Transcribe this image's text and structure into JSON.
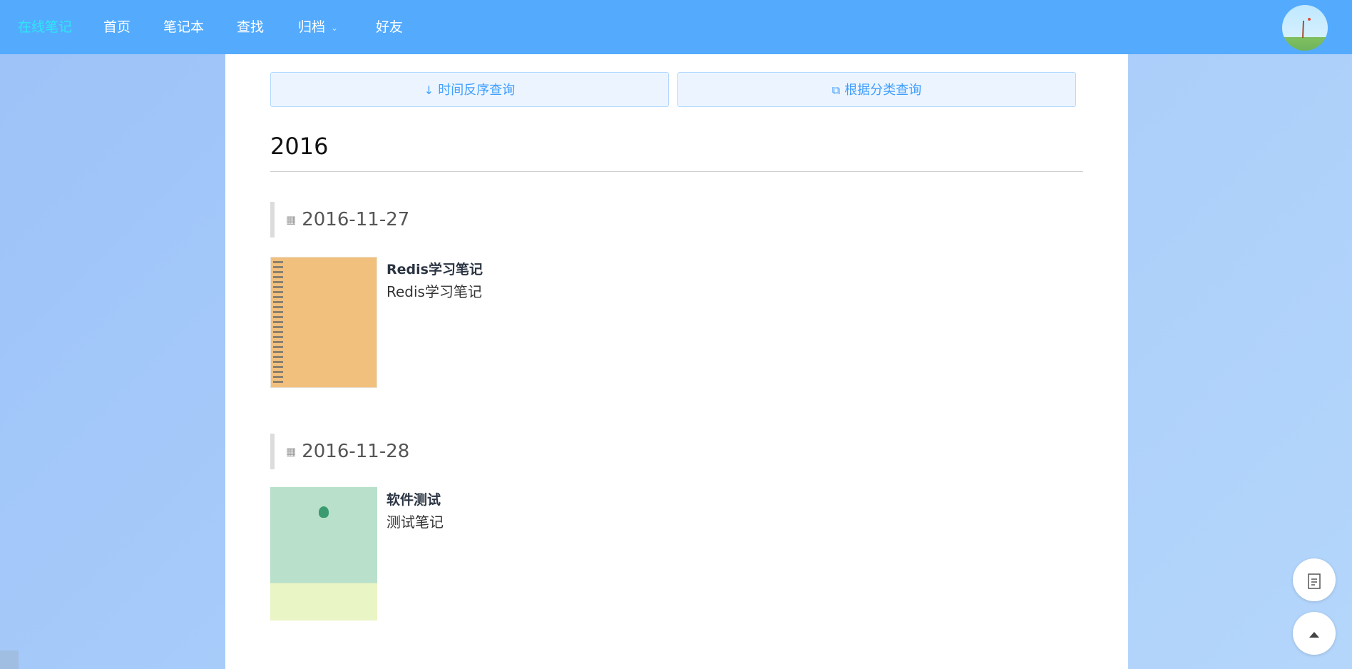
{
  "nav": {
    "brand": "在线笔记",
    "items": [
      "首页",
      "笔记本",
      "查找",
      "归档",
      "好友"
    ],
    "archive_caret": "⌄"
  },
  "actions": {
    "time_reverse_icon": "↓",
    "time_reverse_label": "时间反序查询",
    "by_category_icon": "⧉",
    "by_category_label": "根据分类查询"
  },
  "archive": {
    "year": "2016",
    "groups": [
      {
        "date": "2016-11-27",
        "note": {
          "title": "Redis学习笔记",
          "description": "Redis学习笔记"
        }
      },
      {
        "date": "2016-11-28",
        "note": {
          "title": "软件测试",
          "description": "测试笔记"
        }
      }
    ]
  },
  "icons": {
    "calendar": "calendar-icon",
    "document": "document-icon",
    "back_to_top": "arrow-up-icon"
  },
  "colors": {
    "navbar": "#54abfe",
    "brand": "#2ee6f6",
    "button_bg": "#ecf5ff",
    "button_text": "#409eff"
  }
}
